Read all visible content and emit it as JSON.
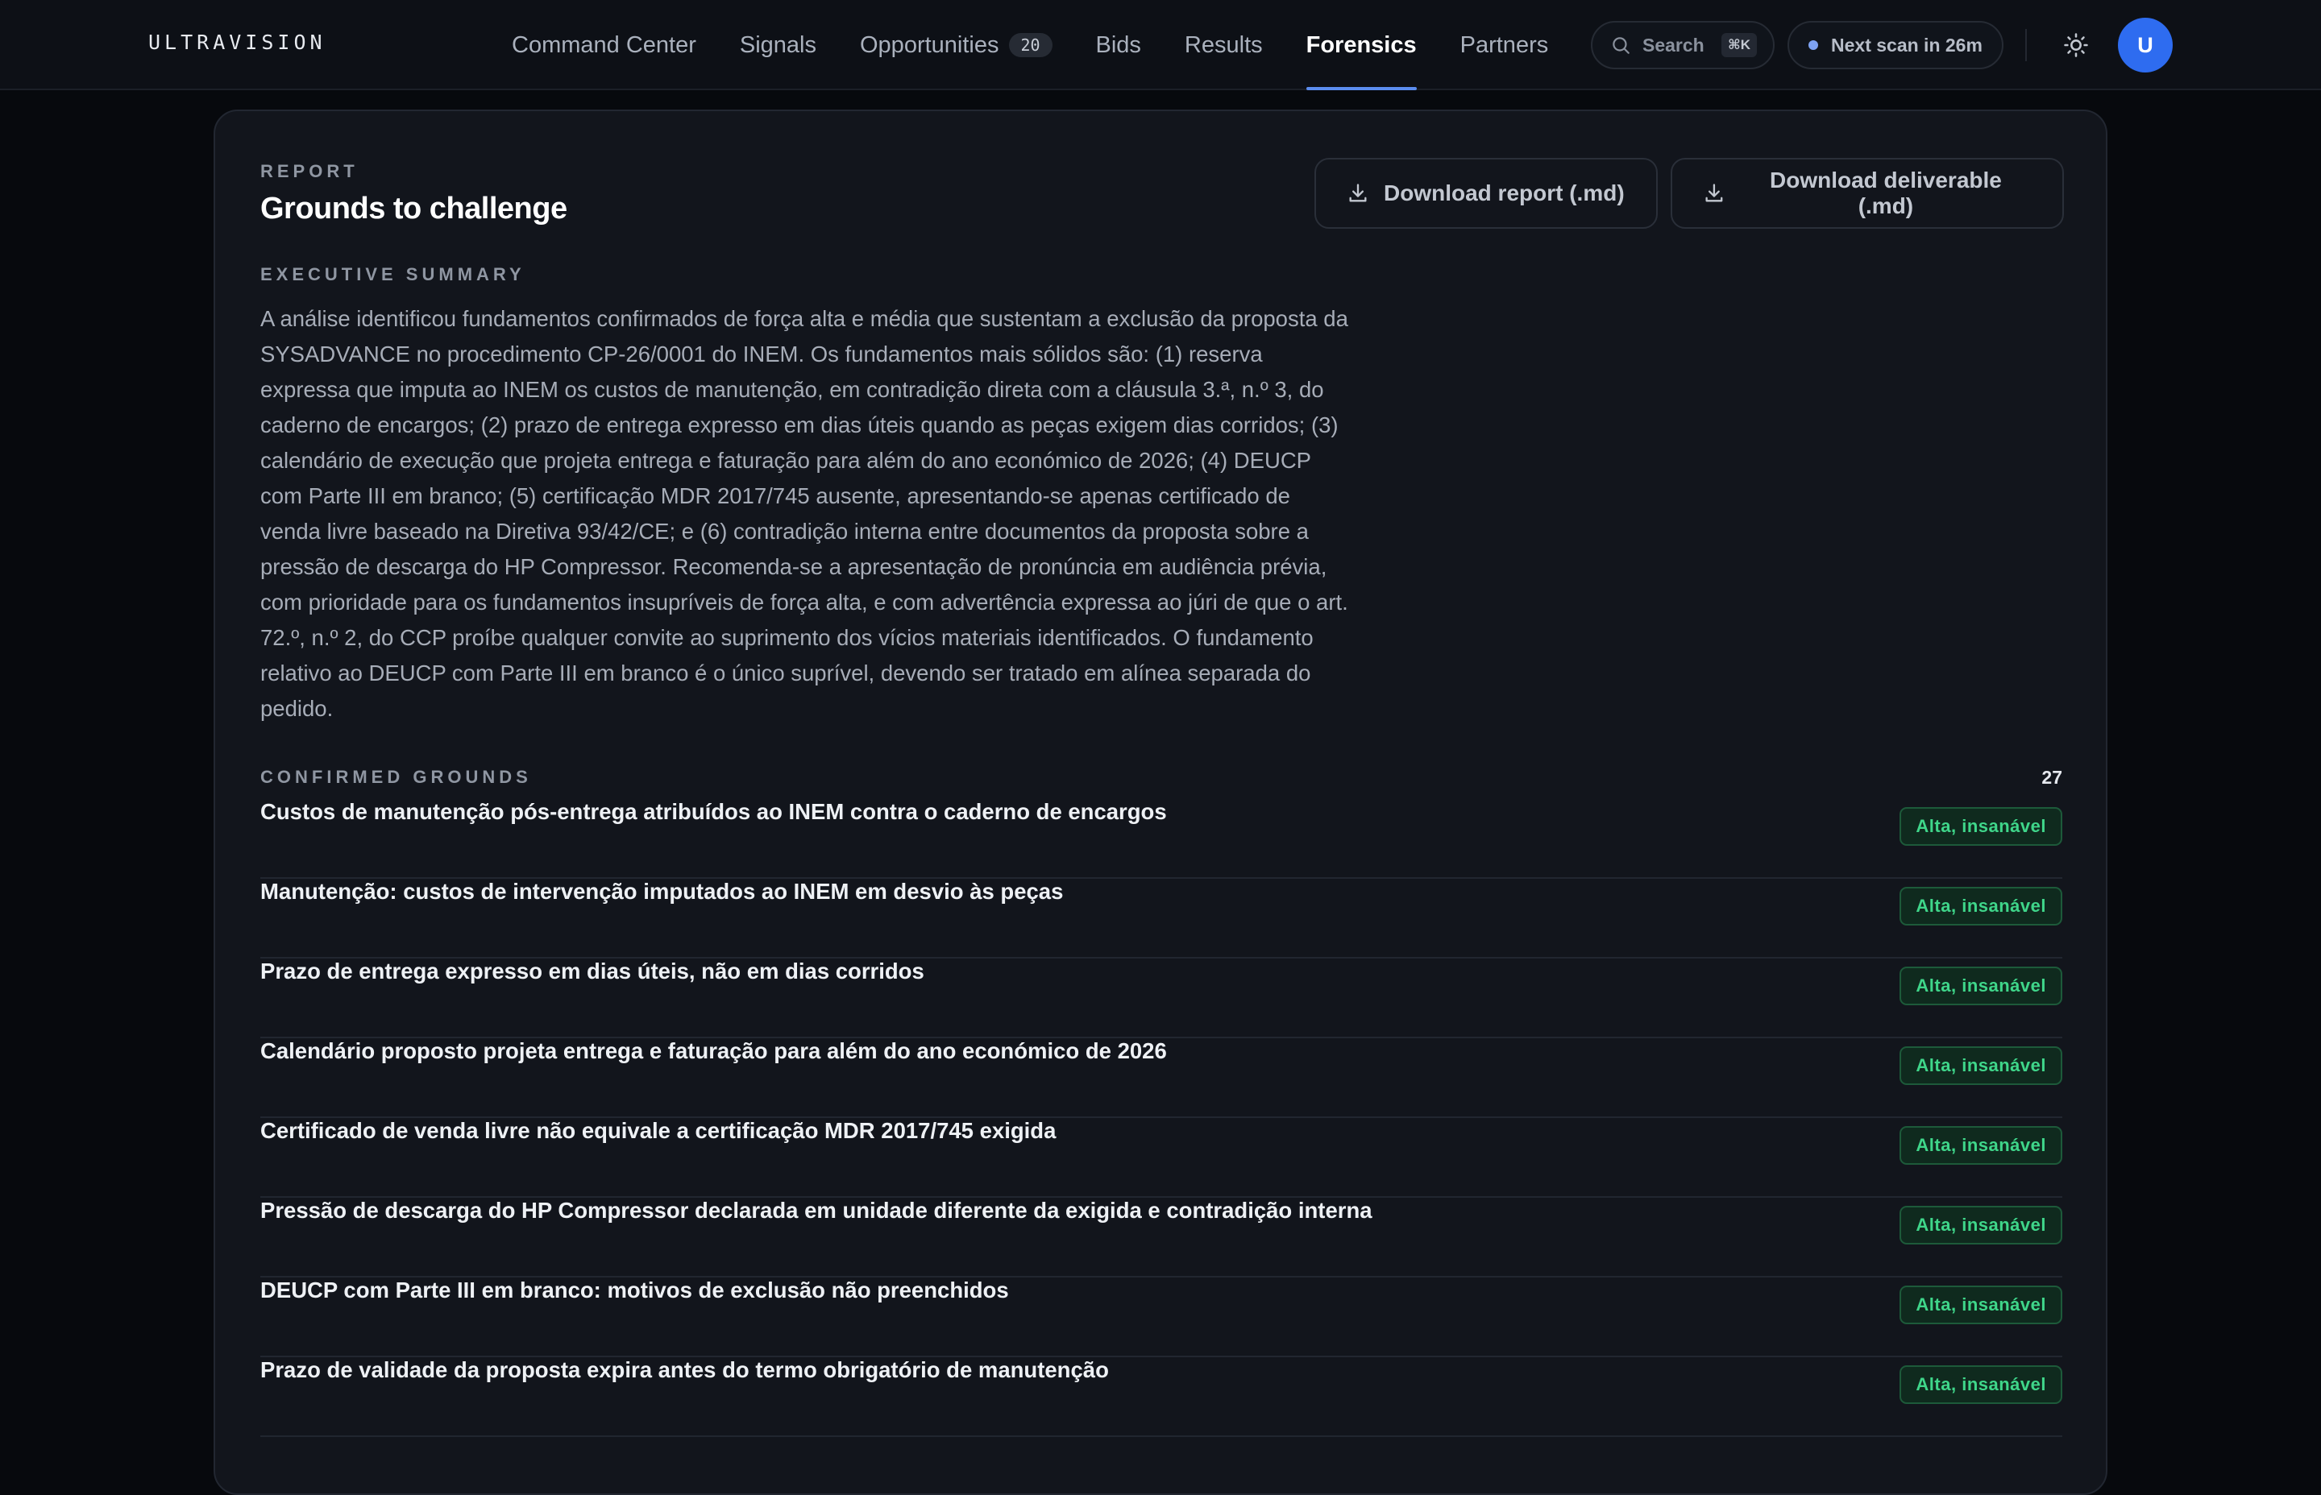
{
  "app": {
    "brand": "ULTRAVISION"
  },
  "nav": {
    "items": [
      {
        "label": "Command Center"
      },
      {
        "label": "Signals"
      },
      {
        "label": "Opportunities",
        "count": "20"
      },
      {
        "label": "Bids"
      },
      {
        "label": "Results"
      },
      {
        "label": "Forensics",
        "active": true
      },
      {
        "label": "Partners"
      }
    ]
  },
  "header": {
    "search_label": "Search",
    "search_shortcut": "⌘K",
    "scan_status": "Next scan in 26m",
    "avatar_initial": "U",
    "accent_color": "#5b8def",
    "avatar_color": "#2e6cf0"
  },
  "report": {
    "eyebrow": "REPORT",
    "title": "Grounds to challenge",
    "download_report": "Download report (.md)",
    "download_deliverable": "Download deliverable (.md)",
    "summary_label": "EXECUTIVE SUMMARY",
    "summary": "A análise identificou fundamentos confirmados de força alta e média que sustentam a exclusão da proposta da SYSADVANCE no procedimento CP-26/0001 do INEM. Os fundamentos mais sólidos são: (1) reserva expressa que imputa ao INEM os custos de manutenção, em contradição direta com a cláusula 3.ª, n.º 3, do caderno de encargos; (2) prazo de entrega expresso em dias úteis quando as peças exigem dias corridos; (3) calendário de execução que projeta entrega e faturação para além do ano económico de 2026; (4) DEUCP com Parte III em branco; (5) certificação MDR 2017/745 ausente, apresentando-se apenas certificado de venda livre baseado na Diretiva 93/42/CE; e (6) contradição interna entre documentos da proposta sobre a pressão de descarga do HP Compressor. Recomenda-se a apresentação de pronúncia em audiência prévia, com prioridade para os fundamentos insupríveis de força alta, e com advertência expressa ao júri de que o art. 72.º, n.º 2, do CCP proíbe qualquer convite ao suprimento dos vícios materiais identificados. O fundamento relativo ao DEUCP com Parte III em branco é o único suprível, devendo ser tratado em alínea separada do pedido.",
    "grounds_label": "CONFIRMED GROUNDS",
    "grounds_count": "27",
    "badge_color": "#3fd68a",
    "grounds": [
      {
        "title": "Custos de manutenção pós-entrega atribuídos ao INEM contra o caderno de encargos",
        "badge": "Alta, insanável"
      },
      {
        "title": "Manutenção: custos de intervenção imputados ao INEM em desvio às peças",
        "badge": "Alta, insanável"
      },
      {
        "title": "Prazo de entrega expresso em dias úteis, não em dias corridos",
        "badge": "Alta, insanável"
      },
      {
        "title": "Calendário proposto projeta entrega e faturação para além do ano económico de 2026",
        "badge": "Alta, insanável"
      },
      {
        "title": "Certificado de venda livre não equivale a certificação MDR 2017/745 exigida",
        "badge": "Alta, insanável"
      },
      {
        "title": "Pressão de descarga do HP Compressor declarada em unidade diferente da exigida e contradição interna",
        "badge": "Alta, insanável"
      },
      {
        "title": "DEUCP com Parte III em branco: motivos de exclusão não preenchidos",
        "badge": "Alta, insanável"
      },
      {
        "title": "Prazo de validade da proposta expira antes do termo obrigatório de manutenção",
        "badge": "Alta, insanável"
      }
    ]
  }
}
